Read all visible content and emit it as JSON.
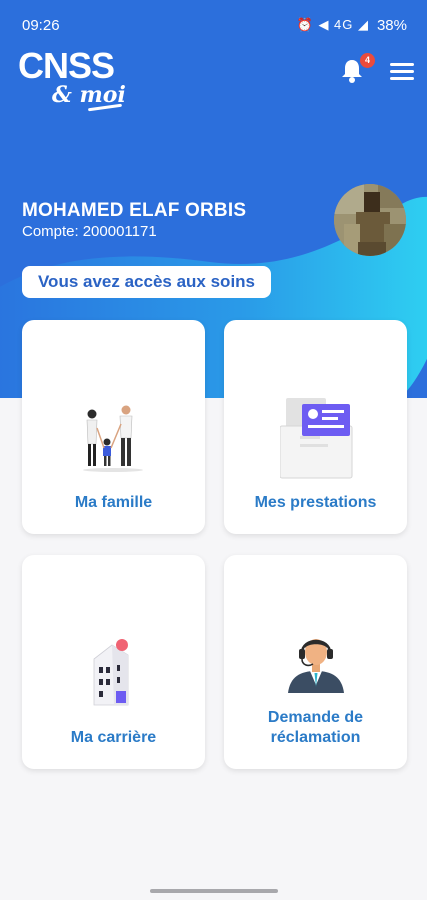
{
  "status_bar": {
    "time": "09:26",
    "icons_text": "⏰ ◀ 4G ◢",
    "battery": "38%"
  },
  "logo": {
    "title": "CNSS",
    "subtitle": "& moi"
  },
  "header": {
    "notification_count": "4"
  },
  "user": {
    "name": "MOHAMED ELAF ORBIS",
    "account_label": "Compte:",
    "account_number": "200001171"
  },
  "access_badge": "Vous avez accès aux soins",
  "cards": [
    {
      "label": "Ma famille"
    },
    {
      "label": "Mes prestations"
    },
    {
      "label": "Ma carrière"
    },
    {
      "label_line1": "Demande de",
      "label_line2": "réclamation"
    }
  ],
  "colors": {
    "primary_blue": "#2c6fdc",
    "wave_cyan": "#2fd0f0",
    "label_blue": "#2b7bc7",
    "badge_red": "#ea4b3c",
    "accent_purple": "#6d5cf2"
  }
}
